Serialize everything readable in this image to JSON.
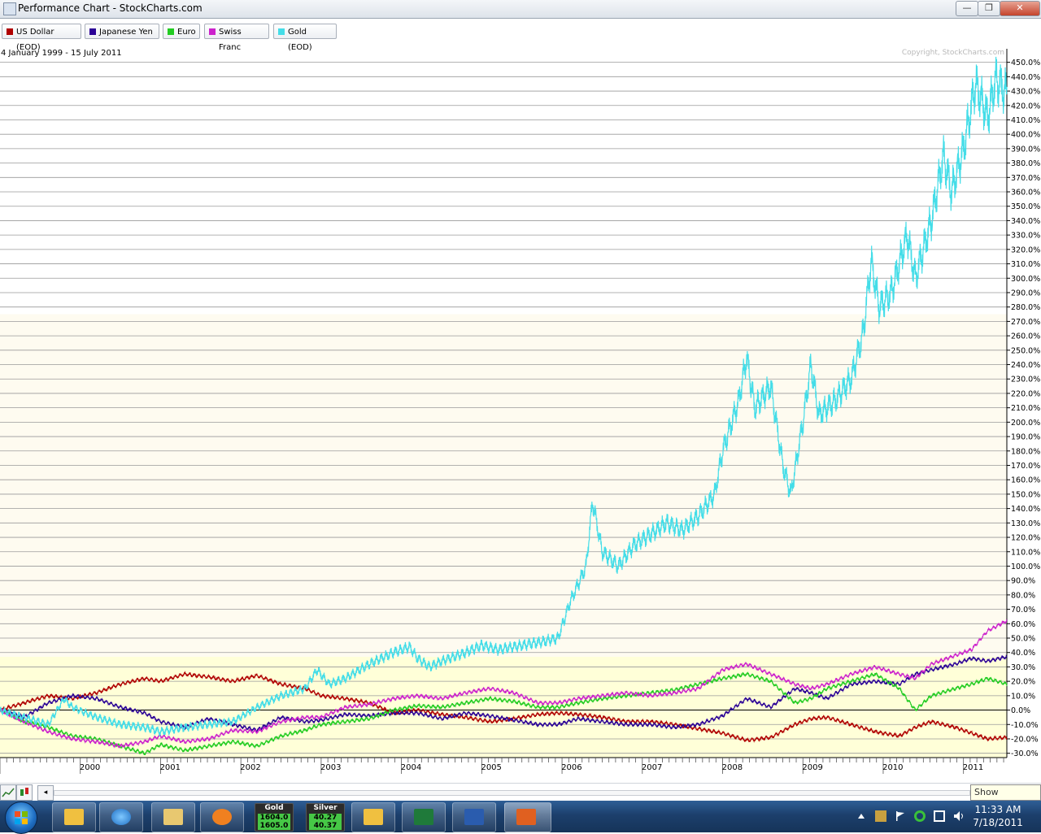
{
  "window": {
    "title": "Performance Chart - StockCharts.com",
    "minimize_label": "—",
    "maximize_label": "❐",
    "close_label": "✕"
  },
  "legend": [
    {
      "label": "US Dollar (EOD)",
      "color": "#b00000"
    },
    {
      "label": "Japanese Yen",
      "color": "#2a0096"
    },
    {
      "label": "Euro",
      "color": "#22cc22"
    },
    {
      "label": "Swiss Franc",
      "color": "#cc22cc"
    },
    {
      "label": "Gold (EOD)",
      "color": "#44dde8"
    }
  ],
  "chart_meta": {
    "date_range": "4 January 1999 - 15 July 2011",
    "copyright": "Copyright, StockCharts.com",
    "band_colors": {
      "upper": "#fefbf0",
      "lower": "#ffffd8"
    }
  },
  "chart_data": {
    "type": "line",
    "x_unit": "year",
    "xlim": [
      1999.0,
      2011.54
    ],
    "ylim": [
      -33,
      456
    ],
    "y_tick_step": 10,
    "y_tick_suffix": "%",
    "x_ticks": [
      "2000",
      "2001",
      "2002",
      "2003",
      "2004",
      "2005",
      "2006",
      "2007",
      "2008",
      "2009",
      "2010",
      "2011"
    ],
    "grid": true,
    "legend_position": "top",
    "series": [
      {
        "name": "US Dollar (EOD)",
        "color": "#b00000",
        "points": [
          [
            1999.0,
            0
          ],
          [
            1999.3,
            5
          ],
          [
            1999.6,
            10
          ],
          [
            1999.9,
            8
          ],
          [
            2000.2,
            12
          ],
          [
            2000.5,
            18
          ],
          [
            2000.8,
            22
          ],
          [
            2001.0,
            20
          ],
          [
            2001.3,
            25
          ],
          [
            2001.6,
            23
          ],
          [
            2001.9,
            20
          ],
          [
            2002.2,
            24
          ],
          [
            2002.5,
            18
          ],
          [
            2002.8,
            15
          ],
          [
            2003.0,
            10
          ],
          [
            2003.3,
            8
          ],
          [
            2003.6,
            5
          ],
          [
            2003.9,
            -2
          ],
          [
            2004.2,
            0
          ],
          [
            2004.5,
            -3
          ],
          [
            2004.8,
            -5
          ],
          [
            2005.1,
            -8
          ],
          [
            2005.4,
            -6
          ],
          [
            2005.7,
            -3
          ],
          [
            2005.95,
            -2
          ],
          [
            2006.2,
            -3
          ],
          [
            2006.5,
            -5
          ],
          [
            2006.8,
            -8
          ],
          [
            2007.1,
            -8
          ],
          [
            2007.4,
            -10
          ],
          [
            2007.7,
            -13
          ],
          [
            2008.0,
            -16
          ],
          [
            2008.3,
            -21
          ],
          [
            2008.6,
            -19
          ],
          [
            2008.9,
            -10
          ],
          [
            2009.1,
            -6
          ],
          [
            2009.3,
            -5
          ],
          [
            2009.6,
            -10
          ],
          [
            2009.9,
            -15
          ],
          [
            2010.2,
            -18
          ],
          [
            2010.4,
            -12
          ],
          [
            2010.6,
            -8
          ],
          [
            2010.9,
            -12
          ],
          [
            2011.1,
            -16
          ],
          [
            2011.3,
            -20
          ],
          [
            2011.54,
            -19
          ]
        ]
      },
      {
        "name": "Japanese Yen",
        "color": "#2a0096",
        "points": [
          [
            1999.0,
            0
          ],
          [
            1999.3,
            -5
          ],
          [
            1999.6,
            5
          ],
          [
            1999.9,
            10
          ],
          [
            2000.2,
            8
          ],
          [
            2000.5,
            2
          ],
          [
            2000.8,
            -2
          ],
          [
            2001.0,
            -8
          ],
          [
            2001.3,
            -12
          ],
          [
            2001.6,
            -6
          ],
          [
            2001.9,
            -10
          ],
          [
            2002.2,
            -14
          ],
          [
            2002.5,
            -5
          ],
          [
            2002.8,
            -8
          ],
          [
            2003.0,
            -7
          ],
          [
            2003.3,
            -3
          ],
          [
            2003.6,
            -4
          ],
          [
            2003.9,
            -2
          ],
          [
            2004.2,
            -2
          ],
          [
            2004.5,
            -6
          ],
          [
            2004.8,
            -2
          ],
          [
            2005.1,
            -4
          ],
          [
            2005.4,
            -7
          ],
          [
            2005.7,
            -10
          ],
          [
            2005.95,
            -10
          ],
          [
            2006.2,
            -6
          ],
          [
            2006.5,
            -8
          ],
          [
            2006.8,
            -10
          ],
          [
            2007.1,
            -10
          ],
          [
            2007.4,
            -12
          ],
          [
            2007.7,
            -10
          ],
          [
            2008.0,
            -4
          ],
          [
            2008.3,
            8
          ],
          [
            2008.6,
            2
          ],
          [
            2008.9,
            15
          ],
          [
            2009.1,
            12
          ],
          [
            2009.3,
            8
          ],
          [
            2009.6,
            18
          ],
          [
            2009.9,
            20
          ],
          [
            2010.2,
            18
          ],
          [
            2010.4,
            25
          ],
          [
            2010.6,
            28
          ],
          [
            2010.9,
            32
          ],
          [
            2011.1,
            36
          ],
          [
            2011.3,
            34
          ],
          [
            2011.54,
            37
          ]
        ]
      },
      {
        "name": "Euro",
        "color": "#22cc22",
        "points": [
          [
            1999.0,
            0
          ],
          [
            1999.3,
            -8
          ],
          [
            1999.6,
            -12
          ],
          [
            1999.9,
            -18
          ],
          [
            2000.2,
            -20
          ],
          [
            2000.5,
            -25
          ],
          [
            2000.8,
            -30
          ],
          [
            2001.0,
            -24
          ],
          [
            2001.3,
            -28
          ],
          [
            2001.6,
            -25
          ],
          [
            2001.9,
            -22
          ],
          [
            2002.2,
            -25
          ],
          [
            2002.5,
            -18
          ],
          [
            2002.8,
            -14
          ],
          [
            2003.0,
            -10
          ],
          [
            2003.3,
            -8
          ],
          [
            2003.6,
            -6
          ],
          [
            2003.9,
            0
          ],
          [
            2004.2,
            3
          ],
          [
            2004.5,
            2
          ],
          [
            2004.8,
            5
          ],
          [
            2005.1,
            8
          ],
          [
            2005.4,
            6
          ],
          [
            2005.7,
            2
          ],
          [
            2005.95,
            2
          ],
          [
            2006.2,
            5
          ],
          [
            2006.5,
            8
          ],
          [
            2006.8,
            10
          ],
          [
            2007.1,
            12
          ],
          [
            2007.4,
            14
          ],
          [
            2007.7,
            18
          ],
          [
            2008.0,
            22
          ],
          [
            2008.3,
            25
          ],
          [
            2008.6,
            20
          ],
          [
            2008.9,
            5
          ],
          [
            2009.1,
            8
          ],
          [
            2009.3,
            15
          ],
          [
            2009.6,
            20
          ],
          [
            2009.9,
            25
          ],
          [
            2010.2,
            15
          ],
          [
            2010.4,
            0
          ],
          [
            2010.6,
            10
          ],
          [
            2010.9,
            15
          ],
          [
            2011.1,
            18
          ],
          [
            2011.3,
            22
          ],
          [
            2011.54,
            18
          ]
        ]
      },
      {
        "name": "Swiss Franc",
        "color": "#cc22cc",
        "points": [
          [
            1999.0,
            0
          ],
          [
            1999.3,
            -8
          ],
          [
            1999.6,
            -15
          ],
          [
            1999.9,
            -20
          ],
          [
            2000.2,
            -22
          ],
          [
            2000.5,
            -25
          ],
          [
            2000.8,
            -22
          ],
          [
            2001.0,
            -18
          ],
          [
            2001.3,
            -22
          ],
          [
            2001.6,
            -20
          ],
          [
            2001.9,
            -14
          ],
          [
            2002.2,
            -15
          ],
          [
            2002.5,
            -8
          ],
          [
            2002.8,
            -5
          ],
          [
            2003.0,
            -5
          ],
          [
            2003.3,
            2
          ],
          [
            2003.6,
            4
          ],
          [
            2003.9,
            8
          ],
          [
            2004.2,
            10
          ],
          [
            2004.5,
            8
          ],
          [
            2004.8,
            12
          ],
          [
            2005.1,
            15
          ],
          [
            2005.4,
            12
          ],
          [
            2005.7,
            5
          ],
          [
            2005.95,
            5
          ],
          [
            2006.2,
            8
          ],
          [
            2006.5,
            10
          ],
          [
            2006.8,
            12
          ],
          [
            2007.1,
            10
          ],
          [
            2007.4,
            12
          ],
          [
            2007.7,
            15
          ],
          [
            2008.0,
            28
          ],
          [
            2008.3,
            32
          ],
          [
            2008.6,
            25
          ],
          [
            2008.9,
            18
          ],
          [
            2009.1,
            15
          ],
          [
            2009.3,
            18
          ],
          [
            2009.6,
            25
          ],
          [
            2009.9,
            30
          ],
          [
            2010.2,
            25
          ],
          [
            2010.4,
            22
          ],
          [
            2010.6,
            32
          ],
          [
            2010.9,
            38
          ],
          [
            2011.1,
            42
          ],
          [
            2011.3,
            55
          ],
          [
            2011.54,
            62
          ]
        ]
      },
      {
        "name": "Gold (EOD)",
        "color": "#44dde8",
        "points": [
          [
            1999.0,
            0
          ],
          [
            1999.3,
            -5
          ],
          [
            1999.6,
            -10
          ],
          [
            1999.8,
            8
          ],
          [
            1999.9,
            2
          ],
          [
            2000.2,
            -5
          ],
          [
            2000.5,
            -10
          ],
          [
            2000.8,
            -12
          ],
          [
            2001.0,
            -15
          ],
          [
            2001.3,
            -12
          ],
          [
            2001.6,
            -10
          ],
          [
            2001.9,
            -8
          ],
          [
            2002.2,
            2
          ],
          [
            2002.5,
            10
          ],
          [
            2002.8,
            15
          ],
          [
            2002.95,
            28
          ],
          [
            2003.1,
            18
          ],
          [
            2003.3,
            22
          ],
          [
            2003.6,
            32
          ],
          [
            2003.9,
            40
          ],
          [
            2004.1,
            44
          ],
          [
            2004.2,
            36
          ],
          [
            2004.35,
            30
          ],
          [
            2004.5,
            34
          ],
          [
            2004.8,
            40
          ],
          [
            2005.0,
            45
          ],
          [
            2005.2,
            42
          ],
          [
            2005.5,
            45
          ],
          [
            2005.8,
            48
          ],
          [
            2005.95,
            50
          ],
          [
            2006.1,
            75
          ],
          [
            2006.3,
            100
          ],
          [
            2006.38,
            145
          ],
          [
            2006.5,
            110
          ],
          [
            2006.7,
            100
          ],
          [
            2006.9,
            115
          ],
          [
            2007.1,
            122
          ],
          [
            2007.3,
            130
          ],
          [
            2007.5,
            125
          ],
          [
            2007.7,
            135
          ],
          [
            2007.9,
            150
          ],
          [
            2008.0,
            180
          ],
          [
            2008.2,
            215
          ],
          [
            2008.3,
            245
          ],
          [
            2008.4,
            210
          ],
          [
            2008.6,
            225
          ],
          [
            2008.75,
            170
          ],
          [
            2008.85,
            150
          ],
          [
            2009.0,
            200
          ],
          [
            2009.1,
            240
          ],
          [
            2009.2,
            205
          ],
          [
            2009.4,
            215
          ],
          [
            2009.6,
            230
          ],
          [
            2009.75,
            262
          ],
          [
            2009.85,
            312
          ],
          [
            2009.95,
            280
          ],
          [
            2010.1,
            290
          ],
          [
            2010.3,
            330
          ],
          [
            2010.4,
            300
          ],
          [
            2010.6,
            340
          ],
          [
            2010.75,
            385
          ],
          [
            2010.85,
            360
          ],
          [
            2011.0,
            390
          ],
          [
            2011.15,
            435
          ],
          [
            2011.3,
            412
          ],
          [
            2011.4,
            438
          ],
          [
            2011.54,
            428
          ]
        ]
      }
    ]
  },
  "toolbar": {
    "left_arrow": "◂",
    "show_desktop": "Show desktop"
  },
  "taskbar": {
    "tickers": [
      {
        "name": "Gold",
        "v1": "1604.0",
        "v2": "1605.0"
      },
      {
        "name": "Silver",
        "v1": "40.27",
        "v2": "40.37"
      }
    ],
    "clock_time": "11:33 AM",
    "clock_date": "7/18/2011"
  }
}
